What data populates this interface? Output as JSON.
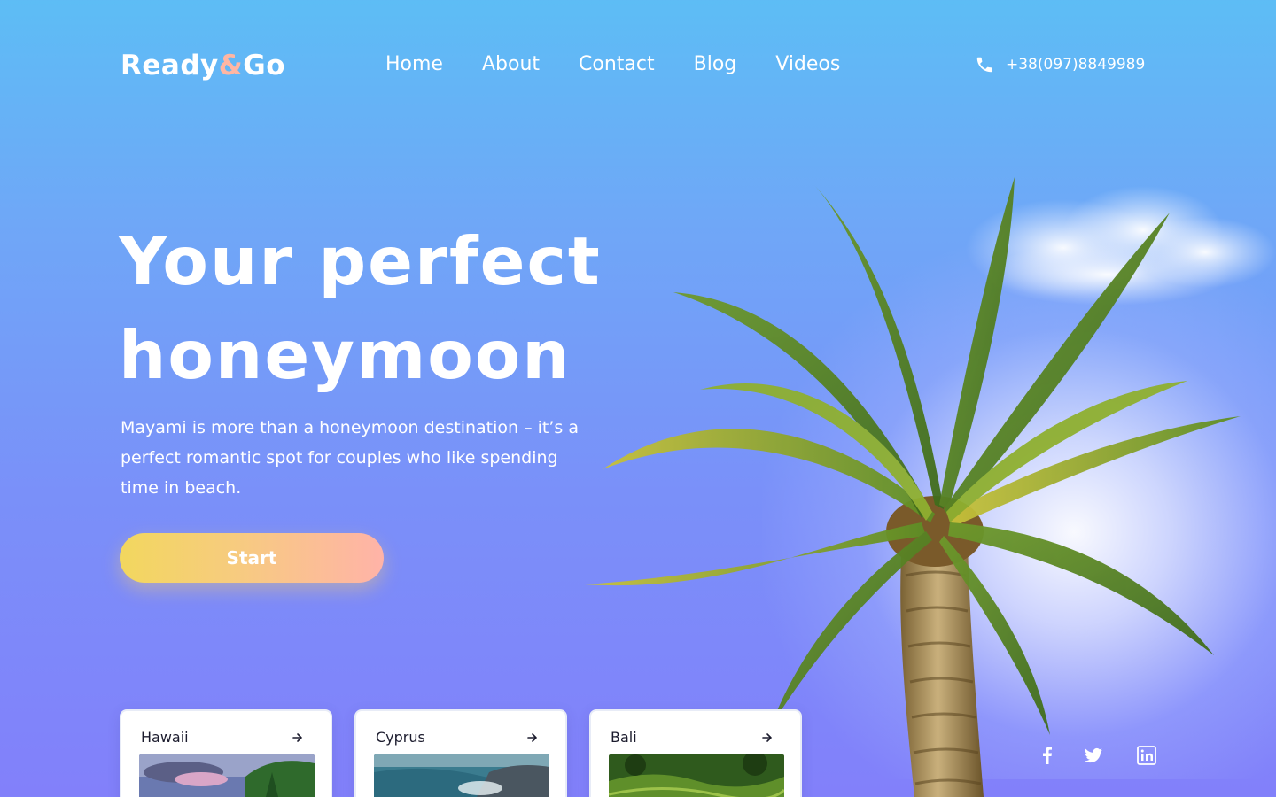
{
  "brand": {
    "name_part1": "Ready",
    "amp": "&",
    "name_part2": "Go"
  },
  "nav": {
    "items": [
      {
        "label": "Home"
      },
      {
        "label": "About"
      },
      {
        "label": "Contact"
      },
      {
        "label": "Blog"
      },
      {
        "label": "Videos"
      }
    ]
  },
  "contact": {
    "phone": "+38(097)8849989",
    "icon": "phone-icon"
  },
  "hero": {
    "title_line1": "Your perfect",
    "title_line2": "honeymoon",
    "description": "Mayami is more than a honeymoon destination – it’s a perfect romantic spot for couples who like spending time in beach.",
    "cta_label": "Start"
  },
  "destinations": [
    {
      "title": "Hawaii",
      "icon": "arrow-right-icon"
    },
    {
      "title": "Cyprus",
      "icon": "arrow-right-icon"
    },
    {
      "title": "Bali",
      "icon": "arrow-right-icon"
    }
  ],
  "social": [
    "facebook-icon",
    "twitter-icon",
    "linkedin-icon"
  ],
  "colors": {
    "accent_amp": "#ffb6a3",
    "cta_gradient_start": "#f2d75e",
    "cta_gradient_end": "#ffb3a8",
    "background_top": "#5dbdf5",
    "background_bottom": "#8280fa"
  }
}
